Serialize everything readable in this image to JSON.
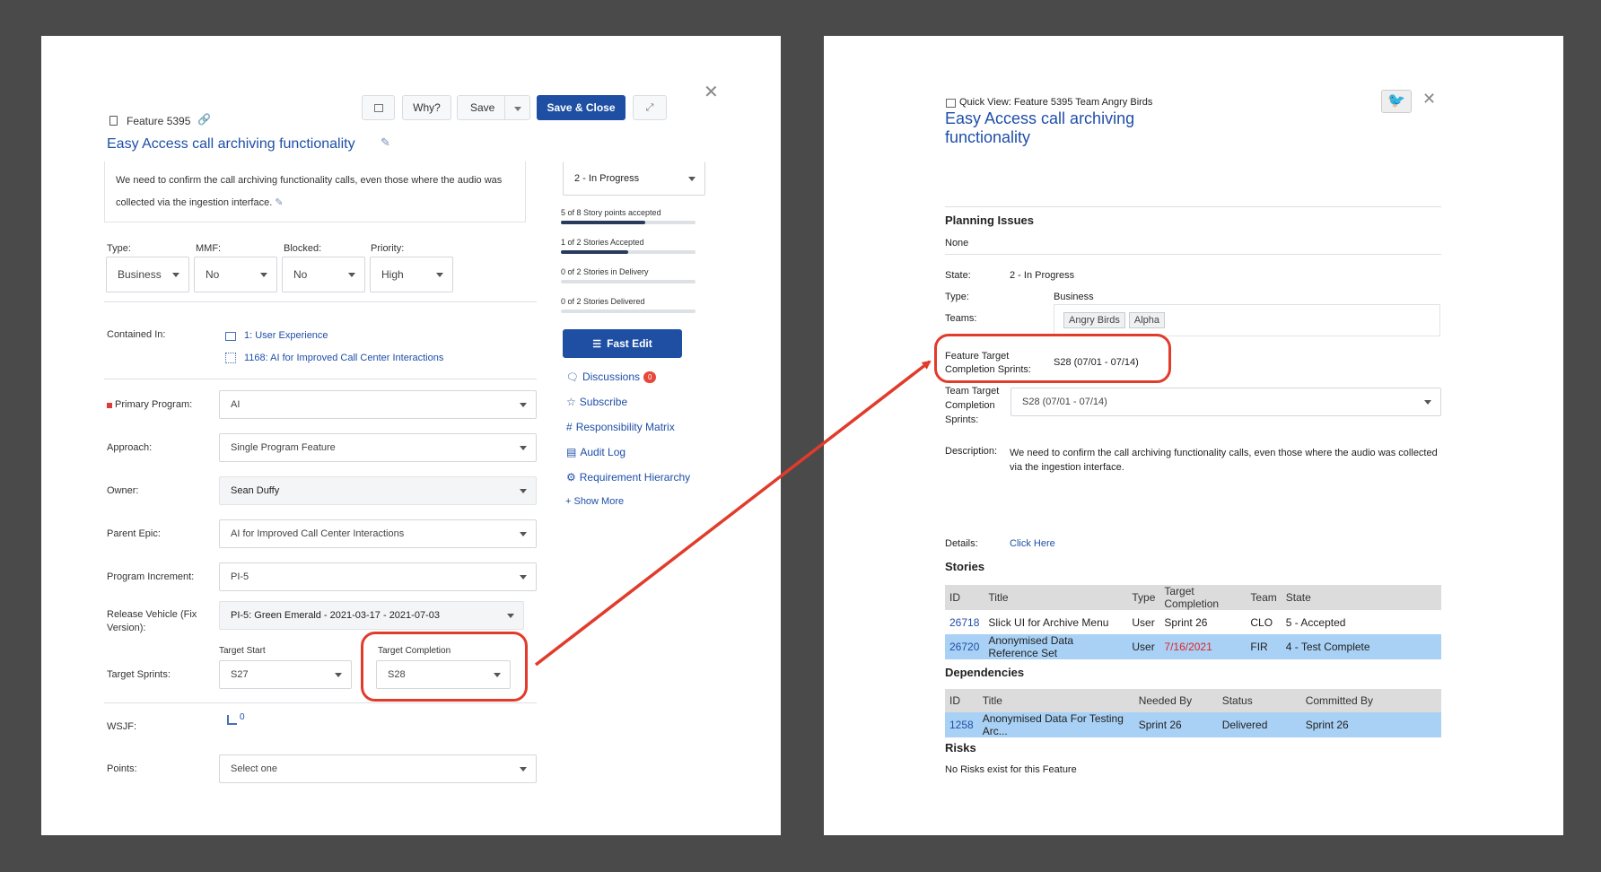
{
  "left": {
    "feature_id": "Feature 5395",
    "title": "Easy Access call archiving functionality",
    "toolbar": {
      "why": "Why?",
      "save": "Save",
      "save_close": "Save & Close"
    },
    "description": "We need to confirm the call archiving functionality calls, even those where the audio was collected via the ingestion interface.",
    "fields": {
      "type_label": "Type:",
      "type_value": "Business",
      "mmf_label": "MMF:",
      "mmf_value": "No",
      "blocked_label": "Blocked:",
      "blocked_value": "No",
      "priority_label": "Priority:",
      "priority_value": "High"
    },
    "contained_in": {
      "label": "Contained In:",
      "items": [
        "1: User Experience",
        "1168: AI for Improved Call Center Interactions"
      ]
    },
    "form": {
      "primary_program_label": "Primary Program:",
      "primary_program": "AI",
      "approach_label": "Approach:",
      "approach": "Single Program Feature",
      "owner_label": "Owner:",
      "owner": "Sean Duffy",
      "parent_epic_label": "Parent Epic:",
      "parent_epic": "AI for Improved Call Center Interactions",
      "pi_label": "Program Increment:",
      "pi": "PI-5",
      "release_label": "Release Vehicle (Fix Version):",
      "release": "PI-5: Green Emerald - 2021-03-17 - 2021-07-03",
      "target_sprints_label": "Target Sprints:",
      "target_start_label": "Target Start",
      "target_start": "S27",
      "target_completion_label": "Target Completion",
      "target_completion": "S28",
      "wsjf_label": "WSJF:",
      "wsjf_value": "0",
      "points_label": "Points:",
      "points": "Select one"
    },
    "state": "2 - In Progress",
    "progress": [
      {
        "label": "5 of 8 Story points accepted",
        "fraction": 0.625
      },
      {
        "label": "1 of 2 Stories Accepted",
        "fraction": 0.5
      },
      {
        "label": "0 of 2 Stories in Delivery",
        "fraction": 0
      },
      {
        "label": "0 of 2 Stories Delivered",
        "fraction": 0
      }
    ],
    "fast_edit": "Fast Edit",
    "side_links": {
      "discussions": "Discussions",
      "discussions_count": "0",
      "subscribe": "Subscribe",
      "matrix": "Responsibility Matrix",
      "audit": "Audit Log",
      "hierarchy": "Requirement Hierarchy",
      "show_more": "+ Show More"
    }
  },
  "right": {
    "header": "Quick View: Feature 5395 Team Angry Birds",
    "title_line1": "Easy Access call archiving",
    "title_line2": "functionality",
    "planning_issues_heading": "Planning Issues",
    "planning_issues_value": "None",
    "state_label": "State:",
    "state": "2 - In Progress",
    "type_label": "Type:",
    "type": "Business",
    "teams_label": "Teams:",
    "teams": [
      "Angry Birds",
      "Alpha"
    ],
    "ftcs_label_1": "Feature Target",
    "ftcs_label_2": "Completion Sprints:",
    "ftcs_value": "S28 (07/01 - 07/14)",
    "ttcs_label_1": "Team Target",
    "ttcs_label_2": "Completion",
    "ttcs_label_3": "Sprints:",
    "ttcs_value": "S28 (07/01 - 07/14)",
    "description_label": "Description:",
    "description": "We need to confirm the call archiving functionality calls, even those where the audio was collected via the ingestion interface.",
    "details_label": "Details:",
    "details_link": "Click Here",
    "stories_heading": "Stories",
    "stories_columns": [
      "ID",
      "Title",
      "Type",
      "Target Completion",
      "Team",
      "State"
    ],
    "stories_rows": [
      [
        "26718",
        "Slick UI for Archive Menu",
        "User",
        "Sprint 26",
        "CLO",
        "5 - Accepted"
      ],
      [
        "26720",
        "Anonymised Data Reference Set",
        "User",
        "7/16/2021",
        "FIR",
        "4 - Test Complete"
      ]
    ],
    "dependencies_heading": "Dependencies",
    "dependencies_columns": [
      "ID",
      "Title",
      "Needed By",
      "Status",
      "Committed By"
    ],
    "dependencies_rows": [
      [
        "1258",
        "Anonymised Data For Testing Arc...",
        "Sprint 26",
        "Delivered",
        "Sprint 26"
      ]
    ],
    "risks_heading": "Risks",
    "risks_value": "No Risks exist for this Feature"
  },
  "colors": {
    "accent": "#1f4fa8",
    "primary_button": "#1e4fa3",
    "highlight_row": "#a9d1f5",
    "callout": "#e13b2b",
    "overdue": "#e02424"
  }
}
